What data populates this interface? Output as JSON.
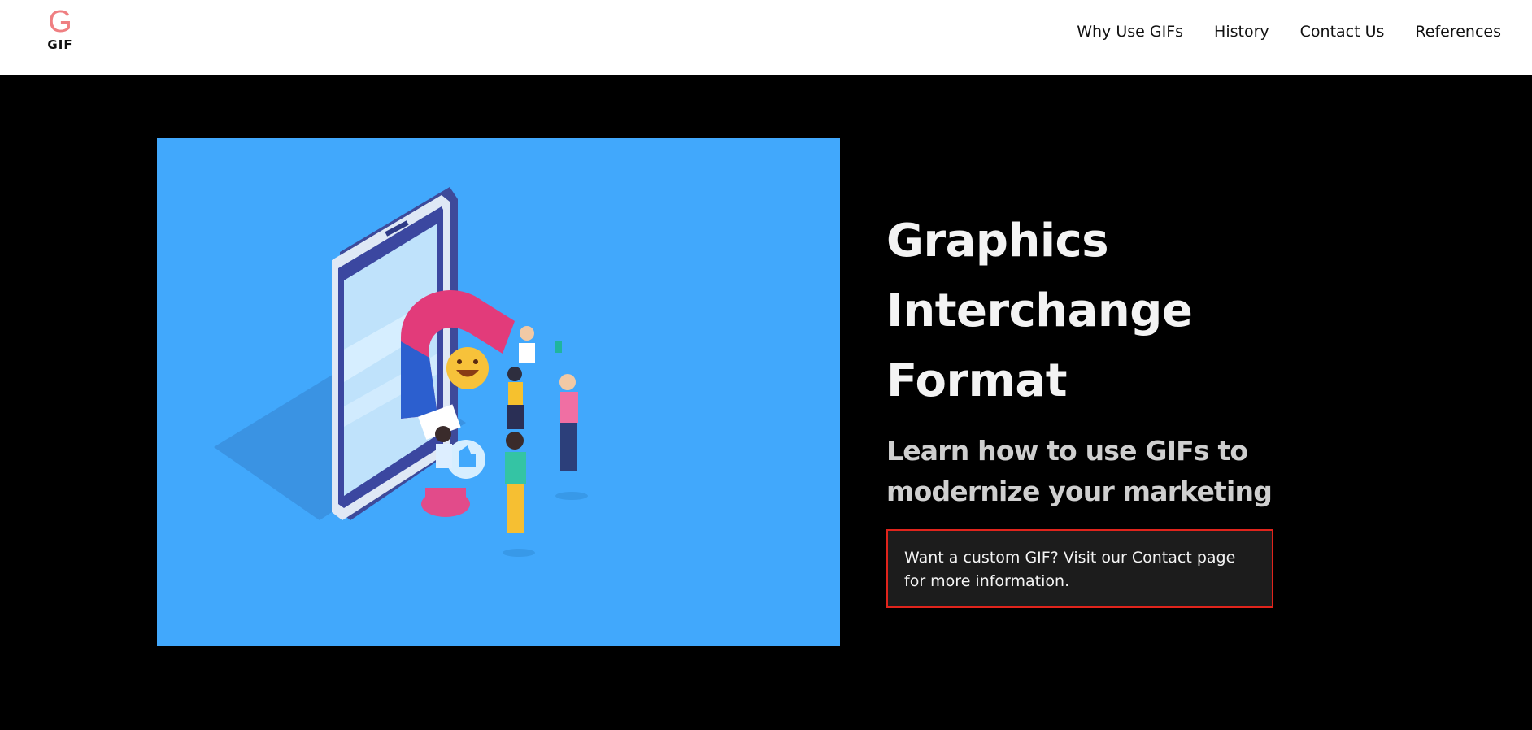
{
  "header": {
    "logo_letter": "G",
    "logo_text": "GIF",
    "nav": [
      {
        "label": "Why Use GIFs"
      },
      {
        "label": "History"
      },
      {
        "label": "Contact Us"
      },
      {
        "label": "References"
      }
    ]
  },
  "hero": {
    "title_lines": [
      "Graphics",
      "Interchange",
      "Format"
    ],
    "subtitle_lines": [
      "Learn how to use GIFs to",
      "modernize your marketing"
    ],
    "cta_text": "Want a custom GIF? Visit our Contact page for more information."
  },
  "colors": {
    "header_bg": "#ffffff",
    "page_bg": "#000000",
    "logo_accent": "#ef7f82",
    "illustration_bg": "#41a8fc",
    "cta_border": "#e0241c",
    "cta_bg": "#1c1c1c"
  },
  "icons": {
    "illustration": "phone-magnet-people-illustration"
  }
}
